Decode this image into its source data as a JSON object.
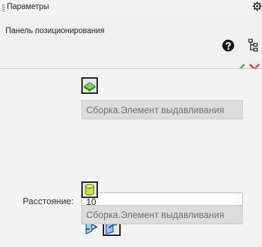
{
  "window": {
    "title": "Параметры",
    "settings_icon": "gear-icon"
  },
  "header": {
    "subtitle": "Панель позиционирования",
    "help_icon": "help-icon",
    "tree_icon": "tree-structure-icon",
    "ok_icon": "checkmark-icon",
    "cancel_icon": "close-icon"
  },
  "form": {
    "first_element": {
      "icon": "extrusion-element-icon",
      "value": "Сборка.Элемент выдавливания"
    },
    "distance": {
      "label": "Расстояние:",
      "value": "10"
    },
    "orientation": {
      "options": [
        {
          "icon": "flip-direction-icon",
          "selected": false
        },
        {
          "icon": "direction-icon",
          "selected": true
        }
      ]
    },
    "second_element": {
      "icon": "cylinder-element-icon",
      "value": "Сборка.Элемент выдавливания"
    }
  },
  "colors": {
    "ok": "#3cb043",
    "cancel": "#e53935",
    "selection_border": "#1a1a1a",
    "field_background": "#dcdcdc"
  }
}
